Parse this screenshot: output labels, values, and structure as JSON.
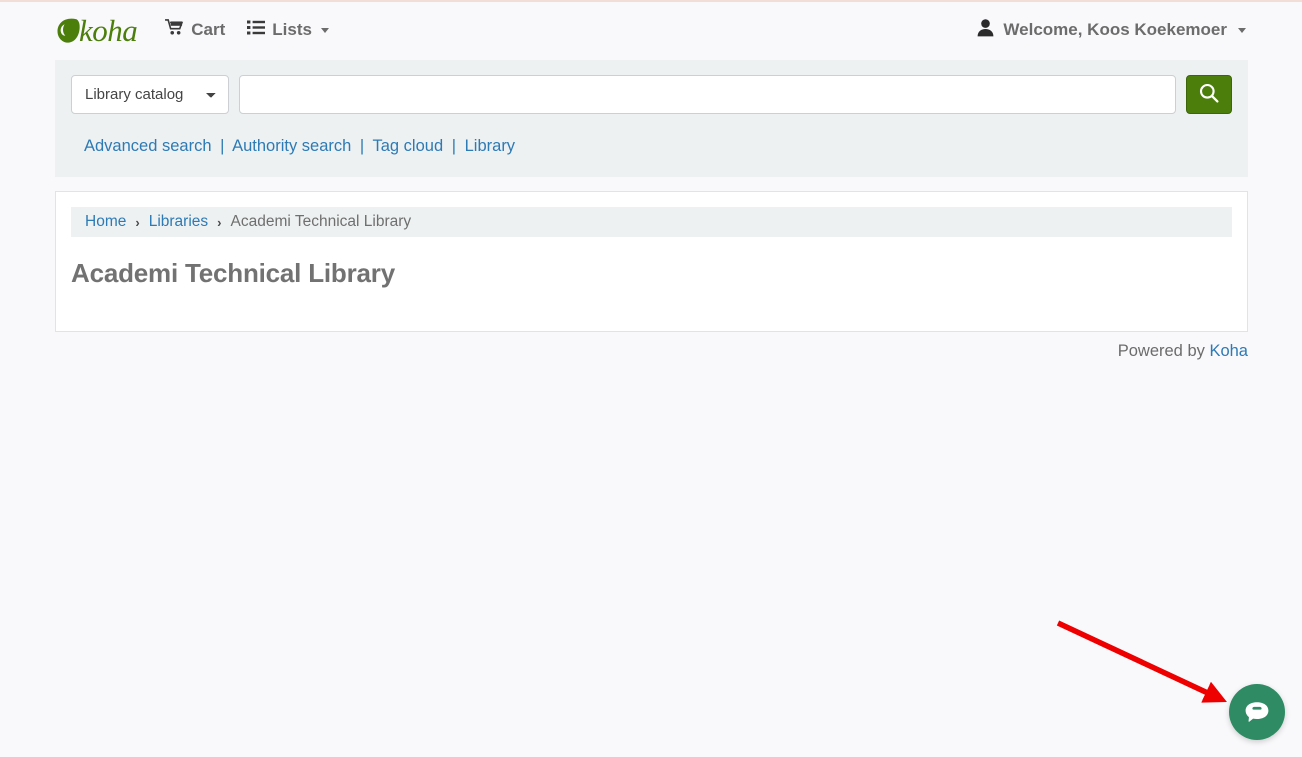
{
  "header": {
    "brand_name": "koha",
    "brand_icon": "leaf-icon",
    "nav_items": [
      {
        "label": "Cart",
        "icon": "shopping-cart-icon",
        "has_caret": false
      },
      {
        "label": "Lists",
        "icon": "list-icon",
        "has_caret": true
      }
    ],
    "user_menu": {
      "label": "Welcome, Koos Koekemoer",
      "icon": "user-icon",
      "has_caret": true
    }
  },
  "search": {
    "selected_scope": "Library catalog",
    "scope_options": [
      "Library catalog"
    ],
    "query_value": "",
    "placeholder": "",
    "submit_icon": "search-icon",
    "quick_links": [
      {
        "label": "Advanced search"
      },
      {
        "label": "Authority search"
      },
      {
        "label": "Tag cloud"
      },
      {
        "label": "Library"
      }
    ],
    "separator": "|"
  },
  "breadcrumb": {
    "items": [
      {
        "label": "Home",
        "current": false
      },
      {
        "label": "Libraries",
        "current": false
      },
      {
        "label": "Academi Technical Library",
        "current": true
      }
    ],
    "separator": "›"
  },
  "main": {
    "page_title": "Academi Technical Library"
  },
  "footer": {
    "powered_by_text": "Powered by ",
    "powered_by_link": "Koha"
  },
  "chat_widget": {
    "icon": "chat-bubble-icon",
    "color": "#2e8b63"
  },
  "annotation": {
    "type": "arrow",
    "color": "#ee0000",
    "points_to": "chat-widget-button"
  },
  "colors": {
    "brand_green": "#4c7e0b",
    "link_blue": "#2d7ab5",
    "page_background": "#f9f8fb",
    "search_band": "#edf1f2",
    "chat_green": "#2e8b63",
    "annotation_red": "#ee0000"
  }
}
